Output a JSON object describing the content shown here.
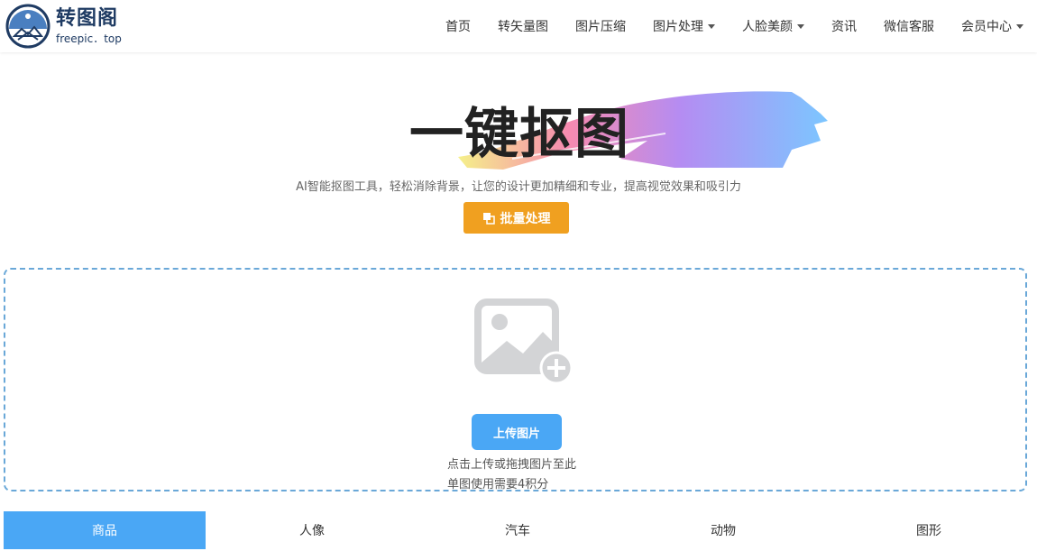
{
  "brand": {
    "name": "转图阁",
    "domain": "freepic．top"
  },
  "nav": {
    "items": [
      {
        "label": "首页",
        "dropdown": false
      },
      {
        "label": "转矢量图",
        "dropdown": false
      },
      {
        "label": "图片压缩",
        "dropdown": false
      },
      {
        "label": "图片处理",
        "dropdown": true
      },
      {
        "label": "人脸美颜",
        "dropdown": true
      },
      {
        "label": "资讯",
        "dropdown": false
      },
      {
        "label": "微信客服",
        "dropdown": false
      },
      {
        "label": "会员中心",
        "dropdown": true
      }
    ]
  },
  "hero": {
    "title": "一键抠图",
    "subtitle": "AI智能抠图工具，轻松消除背景，让您的设计更加精细和专业，提高视觉效果和吸引力",
    "batch_label": "批量处理"
  },
  "upload": {
    "button_label": "上传图片",
    "hint": "点击上传或拖拽图片至此",
    "cost": "单图使用需要4积分"
  },
  "categories": {
    "tabs": [
      "商品",
      "人像",
      "汽车",
      "动物",
      "图形"
    ],
    "active_index": 0
  },
  "colors": {
    "accent": "#4aa7f5",
    "batch": "#f0a020",
    "brand": "#1f3b63",
    "dashed": "#6aa8d8"
  }
}
